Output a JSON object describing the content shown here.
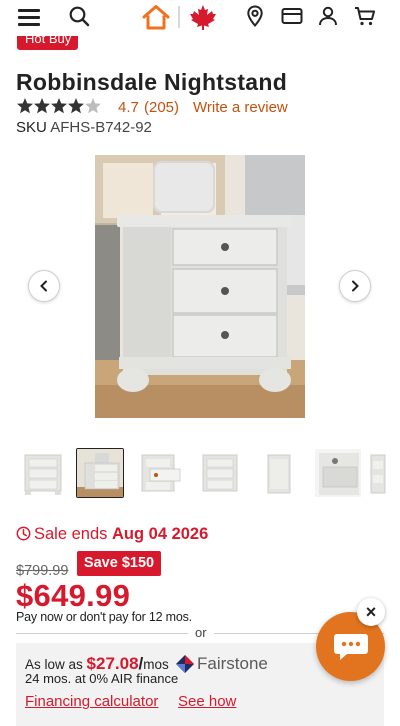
{
  "header": {
    "icons": [
      "menu-icon",
      "search-icon",
      "home-logo-icon",
      "maple-leaf-icon",
      "location-icon",
      "credit-card-icon",
      "account-icon",
      "cart-icon"
    ],
    "accent_color": "#f2711c",
    "leaf_color": "#d7192d"
  },
  "product": {
    "badge": "Hot Buy",
    "title": "Robbinsdale Nightstand",
    "rating": 4.7,
    "rating_text": "4.7",
    "review_count": "(205)",
    "write_review": "Write a review",
    "sku_label": "SKU",
    "sku": "AFHS-B742-92"
  },
  "gallery": {
    "prev_icon": "chevron-left-icon",
    "next_icon": "chevron-right-icon",
    "thumbnail_count": 7,
    "active_index": 1
  },
  "pricing": {
    "sale_prefix": "Sale ends ",
    "sale_date": "Aug 04 2026",
    "was_price": "$799.99",
    "save_badge": "Save $150",
    "price": "$649.99",
    "pay_later": "Pay now or don't pay for 12 mos.",
    "or": "or",
    "brand_color": "#d7192d"
  },
  "financing": {
    "as_low_prefix": "As low as ",
    "amount": "$27.08",
    "per": "/",
    "period": "mos",
    "terms": "24 mos. at 0% AIR finance",
    "provider": "Fairstone",
    "calculator_link": "Financing calculator",
    "see_how_link": "See how"
  },
  "chat": {
    "close_glyph": "×",
    "color": "#e2741f"
  }
}
